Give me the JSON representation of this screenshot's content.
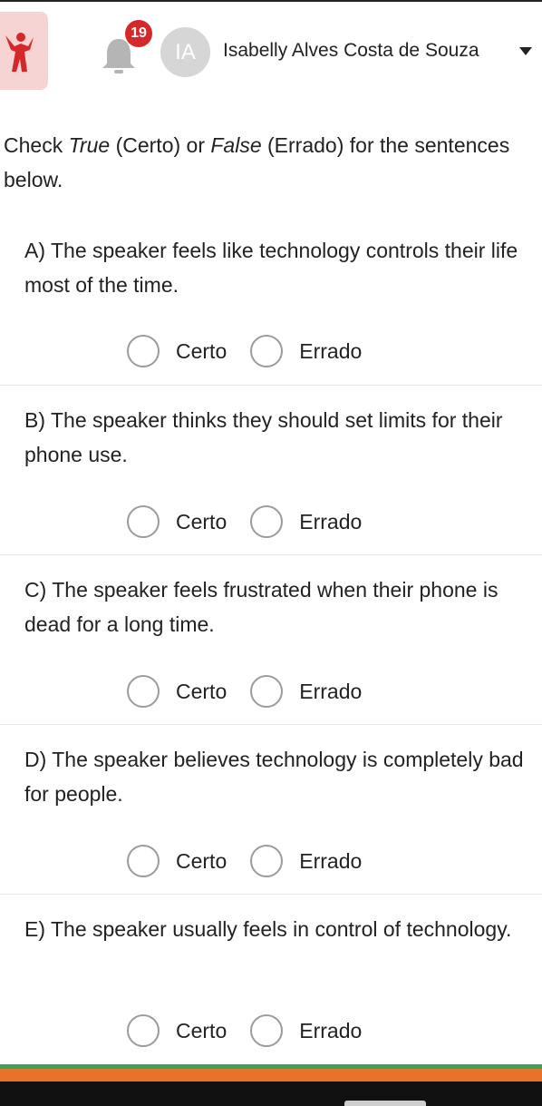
{
  "header": {
    "notification_count": "19",
    "avatar_initials": "IA",
    "user_name": "Isabelly Alves Costa de Souza"
  },
  "instructions": {
    "part1": "Check ",
    "true_word": "True",
    "part2": " (Certo) or ",
    "false_word": "False",
    "part3": " (Errado) for the sentences below."
  },
  "questions": [
    {
      "text": "A) The speaker feels like technology controls their life most of the time.",
      "option_true": "Certo",
      "option_false": "Errado"
    },
    {
      "text": "B) The speaker thinks they should set limits for their phone use.",
      "option_true": "Certo",
      "option_false": "Errado"
    },
    {
      "text": "C) The speaker feels frustrated when their phone is dead for a long time.",
      "option_true": "Certo",
      "option_false": "Errado"
    },
    {
      "text": "D) The speaker believes technology is completely bad for people.",
      "option_true": "Certo",
      "option_false": "Errado"
    },
    {
      "text": "E) The speaker usually feels in control of technology.",
      "option_true": "Certo",
      "option_false": "Errado"
    }
  ],
  "colors": {
    "badge": "#d62828",
    "logo_bg": "#f6d4d4",
    "logo_figure": "#d62828",
    "footer_green": "#3aa35a",
    "footer_orange": "#e9722b"
  }
}
